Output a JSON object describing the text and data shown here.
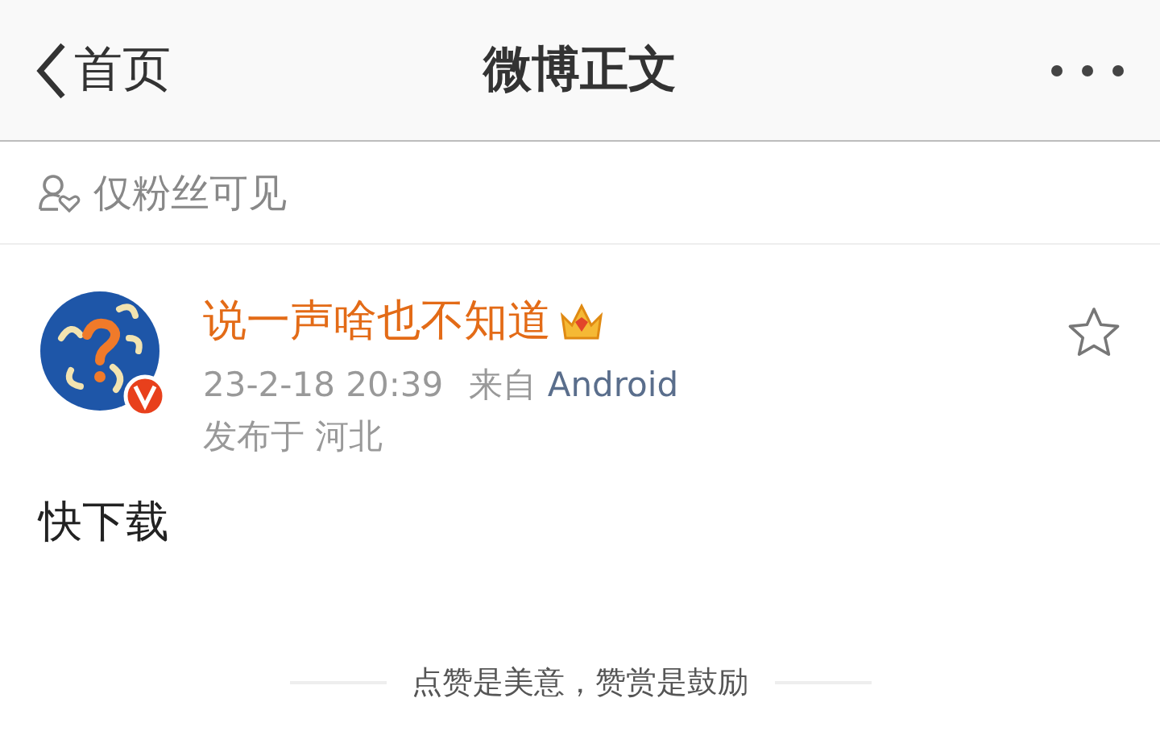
{
  "header": {
    "back_label": "首页",
    "title": "微博正文"
  },
  "visibility": {
    "label": "仅粉丝可见"
  },
  "post": {
    "author": "说一声啥也不知道",
    "timestamp": "23-2-18 20:39",
    "source_prefix": "来自",
    "source": "Android",
    "location": "发布于 河北",
    "starred": false,
    "content": "快下载"
  },
  "footer": {
    "text": "点赞是美意，赞赏是鼓励"
  }
}
